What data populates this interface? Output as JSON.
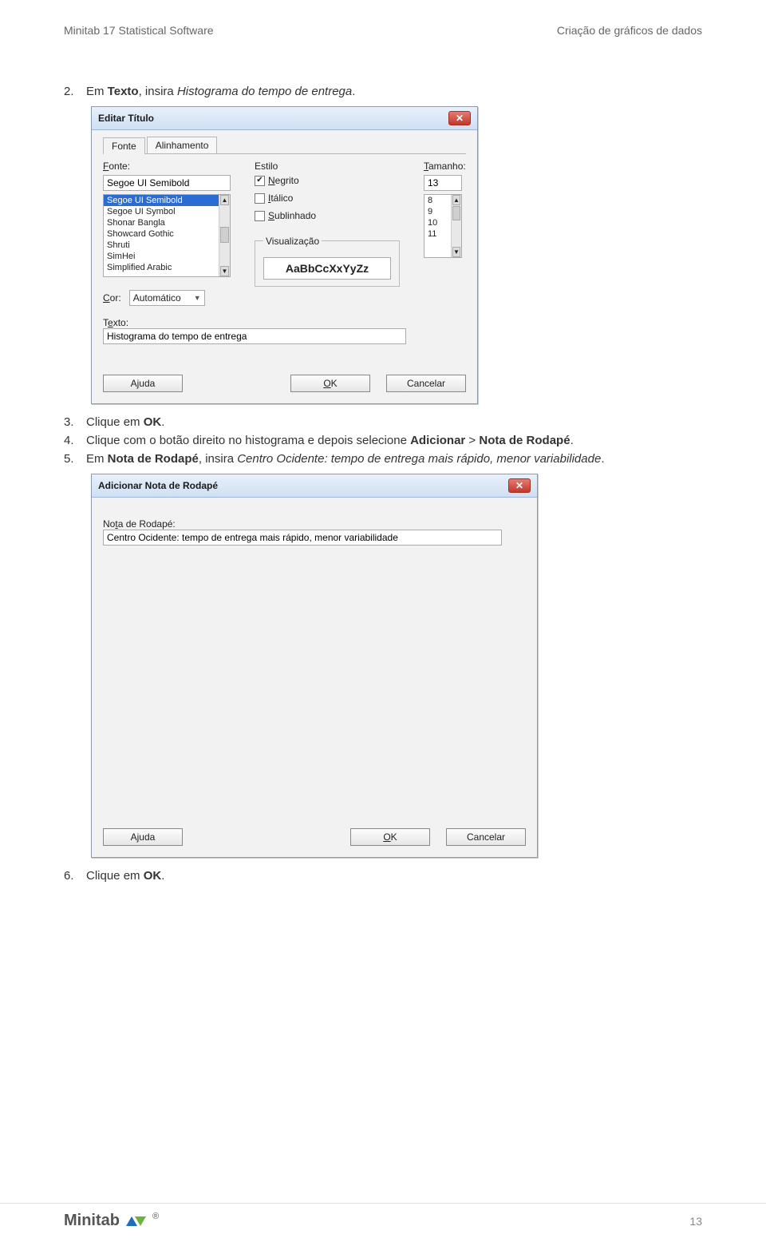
{
  "header": {
    "left": "Minitab 17 Statistical Software",
    "right": "Criação de gráficos de dados"
  },
  "steps": {
    "s2": {
      "num": "2.",
      "pre": "Em ",
      "b1": "Texto",
      "mid": ", insira ",
      "i1": "Histograma do tempo de entrega",
      "suf": "."
    },
    "s3": {
      "num": "3.",
      "pre": "Clique em ",
      "b1": "OK",
      "suf": "."
    },
    "s4": {
      "num": "4.",
      "text_a": "Clique com o botão direito no histograma e depois selecione ",
      "b1": "Adicionar",
      "sep": " > ",
      "b2": "Nota de Rodapé",
      "suf": "."
    },
    "s5": {
      "num": "5.",
      "pre": "Em ",
      "b1": "Nota de Rodapé",
      "mid": ", insira ",
      "i1": "Centro Ocidente: tempo de entrega mais rápido, menor variabilidade",
      "suf": "."
    },
    "s6": {
      "num": "6.",
      "pre": "Clique em ",
      "b1": "OK",
      "suf": "."
    }
  },
  "dlg1": {
    "title": "Editar Título",
    "tabs": {
      "fonte": "Fonte",
      "alinhamento": "Alinhamento"
    },
    "labels": {
      "fonte": "Fonte:",
      "estilo": "Estilo",
      "tamanho": "Tamanho:",
      "visualizacao": "Visualização",
      "cor": "Cor:",
      "texto": "Texto:"
    },
    "font_value": "Segoe UI Semibold",
    "font_list": [
      "Segoe UI Semibold",
      "Segoe UI Symbol",
      "Shonar Bangla",
      "Showcard Gothic",
      "Shruti",
      "SimHei",
      "Simplified Arabic"
    ],
    "styles": {
      "negrito": "Negrito",
      "italico": "Itálico",
      "sublinhado": "Sublinhado"
    },
    "size_value": "13",
    "size_list": [
      "8",
      "9",
      "10",
      "11"
    ],
    "preview": "AaBbCcXxYyZz",
    "cor_value": "Automático",
    "texto_value": "Histograma do tempo de entrega",
    "buttons": {
      "ajuda": "Ajuda",
      "ok": "OK",
      "cancelar": "Cancelar"
    }
  },
  "dlg2": {
    "title": "Adicionar Nota de Rodapé",
    "label": "Nota de Rodapé:",
    "value": "Centro Ocidente: tempo de entrega mais rápido, menor variabilidade",
    "buttons": {
      "ajuda": "Ajuda",
      "ok": "OK",
      "cancelar": "Cancelar"
    }
  },
  "footer": {
    "brand": "Minitab",
    "reg": "®",
    "page": "13"
  }
}
